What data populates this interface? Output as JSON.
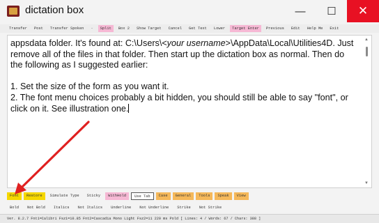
{
  "window": {
    "title": "dictation box",
    "minimize": "—",
    "maximize": "☐",
    "close": "✕"
  },
  "toolbar": [
    {
      "label": "Transfer",
      "highlight": ""
    },
    {
      "label": "Post",
      "highlight": ""
    },
    {
      "label": "Transfer Spoken",
      "highlight": ""
    },
    {
      "label": "·",
      "highlight": ""
    },
    {
      "label": "Split",
      "highlight": "pink"
    },
    {
      "label": "Box 2",
      "highlight": ""
    },
    {
      "label": "Show Target",
      "highlight": ""
    },
    {
      "label": "Cancel",
      "highlight": ""
    },
    {
      "label": "Get Text",
      "highlight": ""
    },
    {
      "label": "Lower",
      "highlight": ""
    },
    {
      "label": "Target Enter",
      "highlight": "pink"
    },
    {
      "label": "Previous",
      "highlight": ""
    },
    {
      "label": "Edit",
      "highlight": ""
    },
    {
      "label": "Help Me",
      "highlight": ""
    },
    {
      "label": "Exit",
      "highlight": ""
    }
  ],
  "editor": {
    "line1": "appsdata folder. It's found at: C:\\Users\\<",
    "line1_italic": "your username",
    "line1_end": ">\\AppData\\Local\\Utilities4D. Just remove all of the files in that folder. Then start up the dictation box as normal. Then do the following as I suggested earlier:",
    "line2": "1. Set the size of the form as you want it.",
    "line3": "2. The font menu choices probably a bit hidden, you should still be able to say \"font\", or click on it. See illustration one."
  },
  "bottom_buttons": [
    {
      "label": "Font",
      "style": "yellow"
    },
    {
      "label": "Restore",
      "style": "yellow"
    },
    {
      "label": "Simulate Type",
      "style": ""
    },
    {
      "label": "Sticky",
      "style": ""
    },
    {
      "label": "WithHold",
      "style": "pink"
    },
    {
      "label": "Use Tab",
      "style": "outlined"
    },
    {
      "label": "Case",
      "style": "orange"
    },
    {
      "label": "General",
      "style": "orange"
    },
    {
      "label": "Tools",
      "style": "orange"
    },
    {
      "label": "Speak",
      "style": "orange"
    },
    {
      "label": "View",
      "style": "orange"
    }
  ],
  "format_buttons": [
    "Bold",
    "Not Bold",
    "Italics",
    "Not Italics",
    "Underline",
    "Not Underline",
    "Strike",
    "Not Strike"
  ],
  "status": "Ver. 8.2.7   Fnt1=Calibri  Fsz1=10.85  Fnt2=Cascadia Mono Light  Fsz2=11    220 ms Pold   [ Lines: 4 / Words: 67 / Chars: 388 ]",
  "colors": {
    "close": "#e81123",
    "yellow": "#f5d700",
    "pink": "#f6b8d4",
    "orange": "#f5b85a",
    "arrow": "#e02020"
  }
}
